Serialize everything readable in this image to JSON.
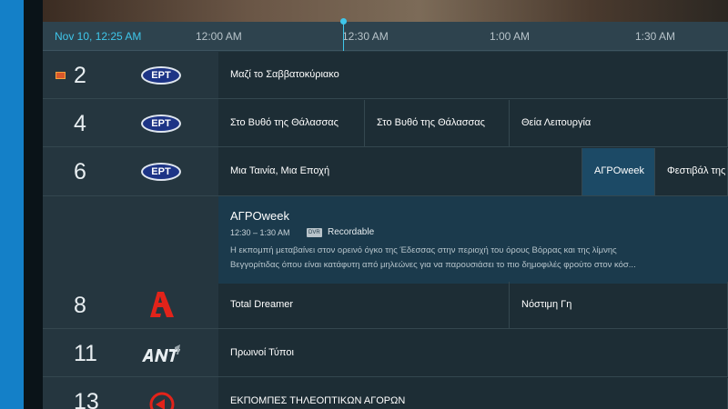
{
  "timebar": {
    "now": "Nov 10, 12:25 AM",
    "ticks": [
      "12:00 AM",
      "12:30 AM",
      "1:00 AM",
      "1:30 AM"
    ]
  },
  "channels": [
    {
      "number": "2",
      "logo": "ERT",
      "recording": true,
      "programs": [
        {
          "title": "Μαζί το Σαββατοκύριακο"
        }
      ]
    },
    {
      "number": "4",
      "logo": "ERT",
      "programs": [
        {
          "title": "Στο Βυθό της Θάλασσας"
        },
        {
          "title": "Στο Βυθό της Θάλασσας"
        },
        {
          "title": "Θεία Λειτουργία"
        }
      ]
    },
    {
      "number": "6",
      "logo": "ERT",
      "programs": [
        {
          "title": "Μια Ταινία, Μια Εποχή"
        },
        {
          "title": "ΑΓΡΟweek",
          "selected": true
        },
        {
          "title": "Φεστιβάλ της"
        }
      ]
    },
    {
      "number": "8",
      "logo": "alpha-logo",
      "programs": [
        {
          "title": "Total Dreamer"
        },
        {
          "title": "Νόστιμη Γη"
        }
      ]
    },
    {
      "number": "11",
      "logo": "ant1-logo",
      "programs": [
        {
          "title": "Πρωινοί Τύποι"
        }
      ]
    },
    {
      "number": "13",
      "logo": "channel-13-logo",
      "programs": [
        {
          "title": "ΕΚΠΟΜΠΕΣ ΤΗΛΕΟΠΤΙΚΩΝ ΑΓΟΡΩΝ"
        }
      ]
    }
  ],
  "detail": {
    "title": "ΑΓΡΟweek",
    "time": "12:30 – 1:30 AM",
    "dvr_badge": "DVR",
    "recordable": "Recordable",
    "description_line1": "Η εκπομπή μεταβαίνει στον ορεινό όγκο της Έδεσσας στην περιοχή του όρους Βόρρας και της λίμνης",
    "description_line2": "Βεγγορίτιδας όπου είναι κατάφυτη από μηλεώνες για να παρουσιάσει το πιο δημοφιλές φρούτο στον κόσ..."
  },
  "colors": {
    "accent": "#3fc6ea",
    "selected_program": "#1c4a66",
    "guide_bg": "#243741",
    "ert_logo": "#1d3486",
    "alpha_logo": "#e2231a"
  },
  "icons": {
    "recording": "recording-icon",
    "dvr": "dvr-badge"
  }
}
